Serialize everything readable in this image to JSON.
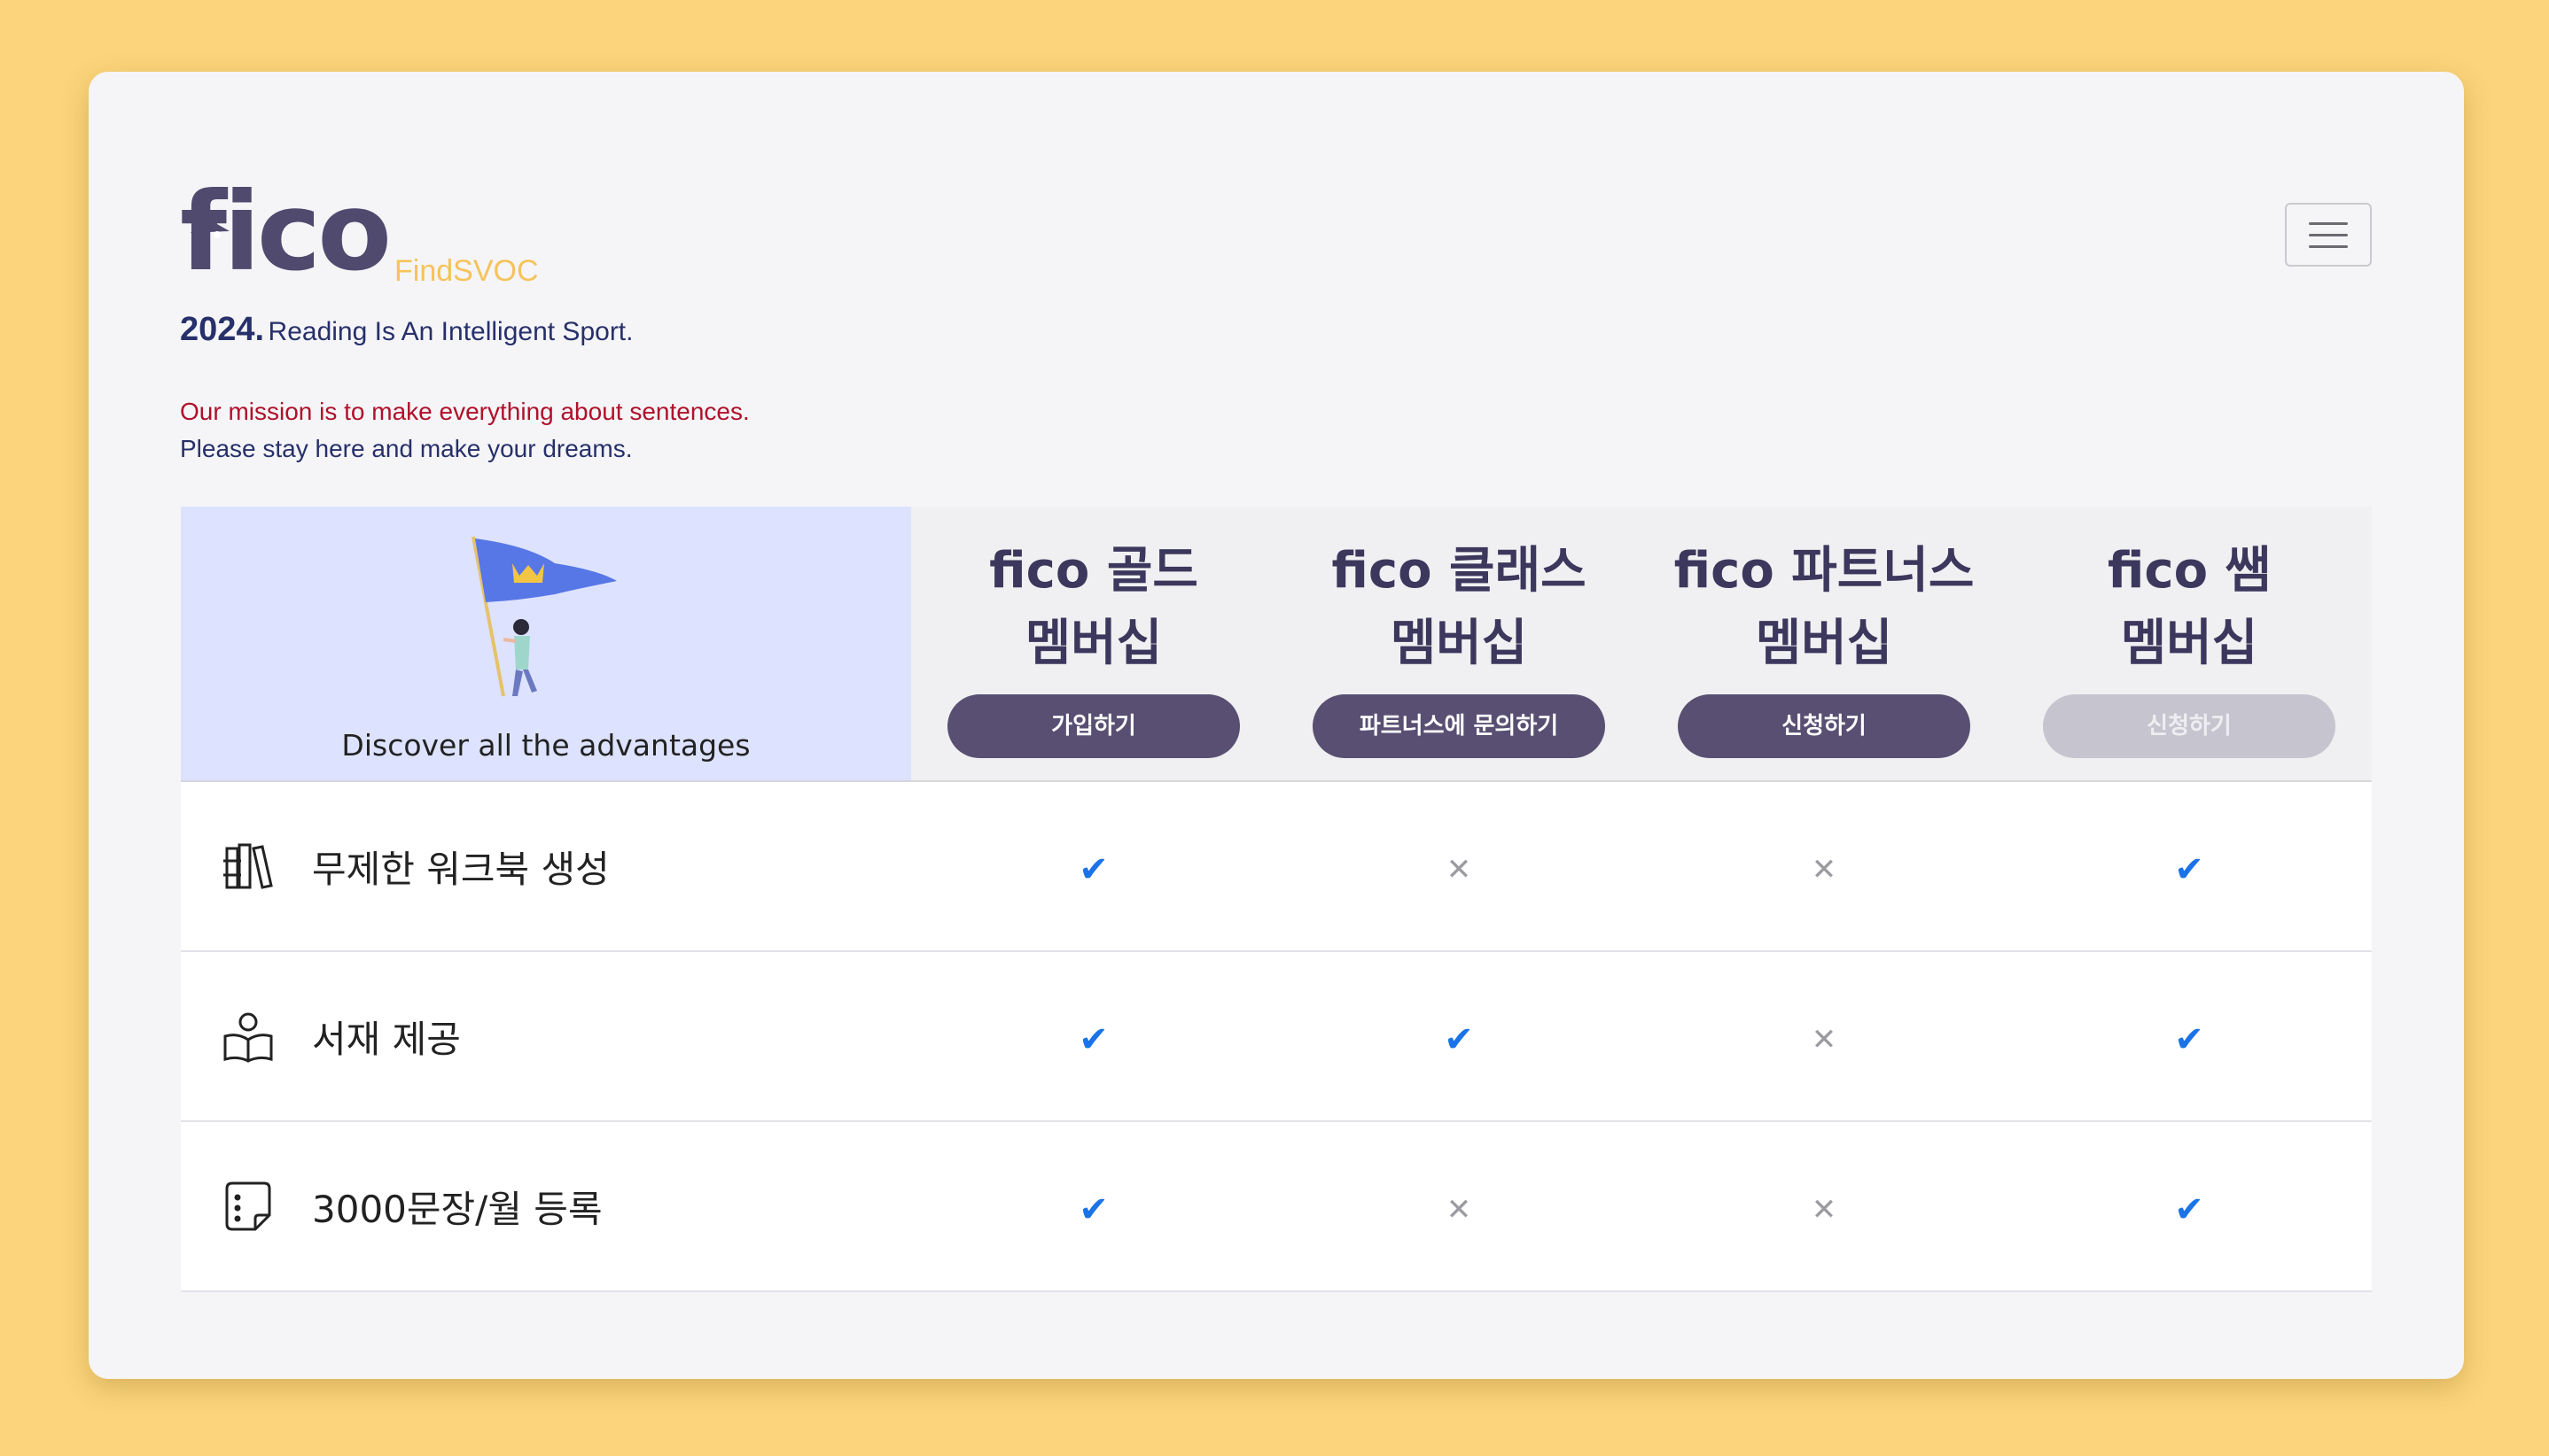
{
  "brand": {
    "logo_text": "fico",
    "logo_sub": "FindSVOC",
    "year": "2024.",
    "motto": "Reading Is An Intelligent Sport.",
    "mission": "Our mission is to make everything about sentences.",
    "stay": "Please stay here and make your dreams."
  },
  "header": {
    "menu_icon": "hamburger-menu-icon"
  },
  "table": {
    "feature_head": "Discover all the advantages",
    "plans": [
      {
        "name": "fico 골드\n멤버십",
        "button": "가입하기",
        "disabled": false
      },
      {
        "name": "fico 클래스\n멤버십",
        "button": "파트너스에 문의하기",
        "disabled": false
      },
      {
        "name": "fico 파트너스\n멤버십",
        "button": "신청하기",
        "disabled": false
      },
      {
        "name": "fico 쌤\n멤버십",
        "button": "신청하기",
        "disabled": true
      }
    ],
    "features": [
      {
        "label": "무제한 워크북 생성",
        "icon": "books-icon",
        "marks": [
          true,
          false,
          false,
          true
        ]
      },
      {
        "label": "서재 제공",
        "icon": "reader-icon",
        "marks": [
          true,
          true,
          false,
          true
        ]
      },
      {
        "label": "3000문장/월 등록",
        "icon": "note-icon",
        "marks": [
          true,
          false,
          false,
          true
        ]
      }
    ]
  },
  "colors": {
    "background": "#fbd47b",
    "accent": "#584f72",
    "check": "#1a73e8",
    "mission": "#b0102a"
  }
}
